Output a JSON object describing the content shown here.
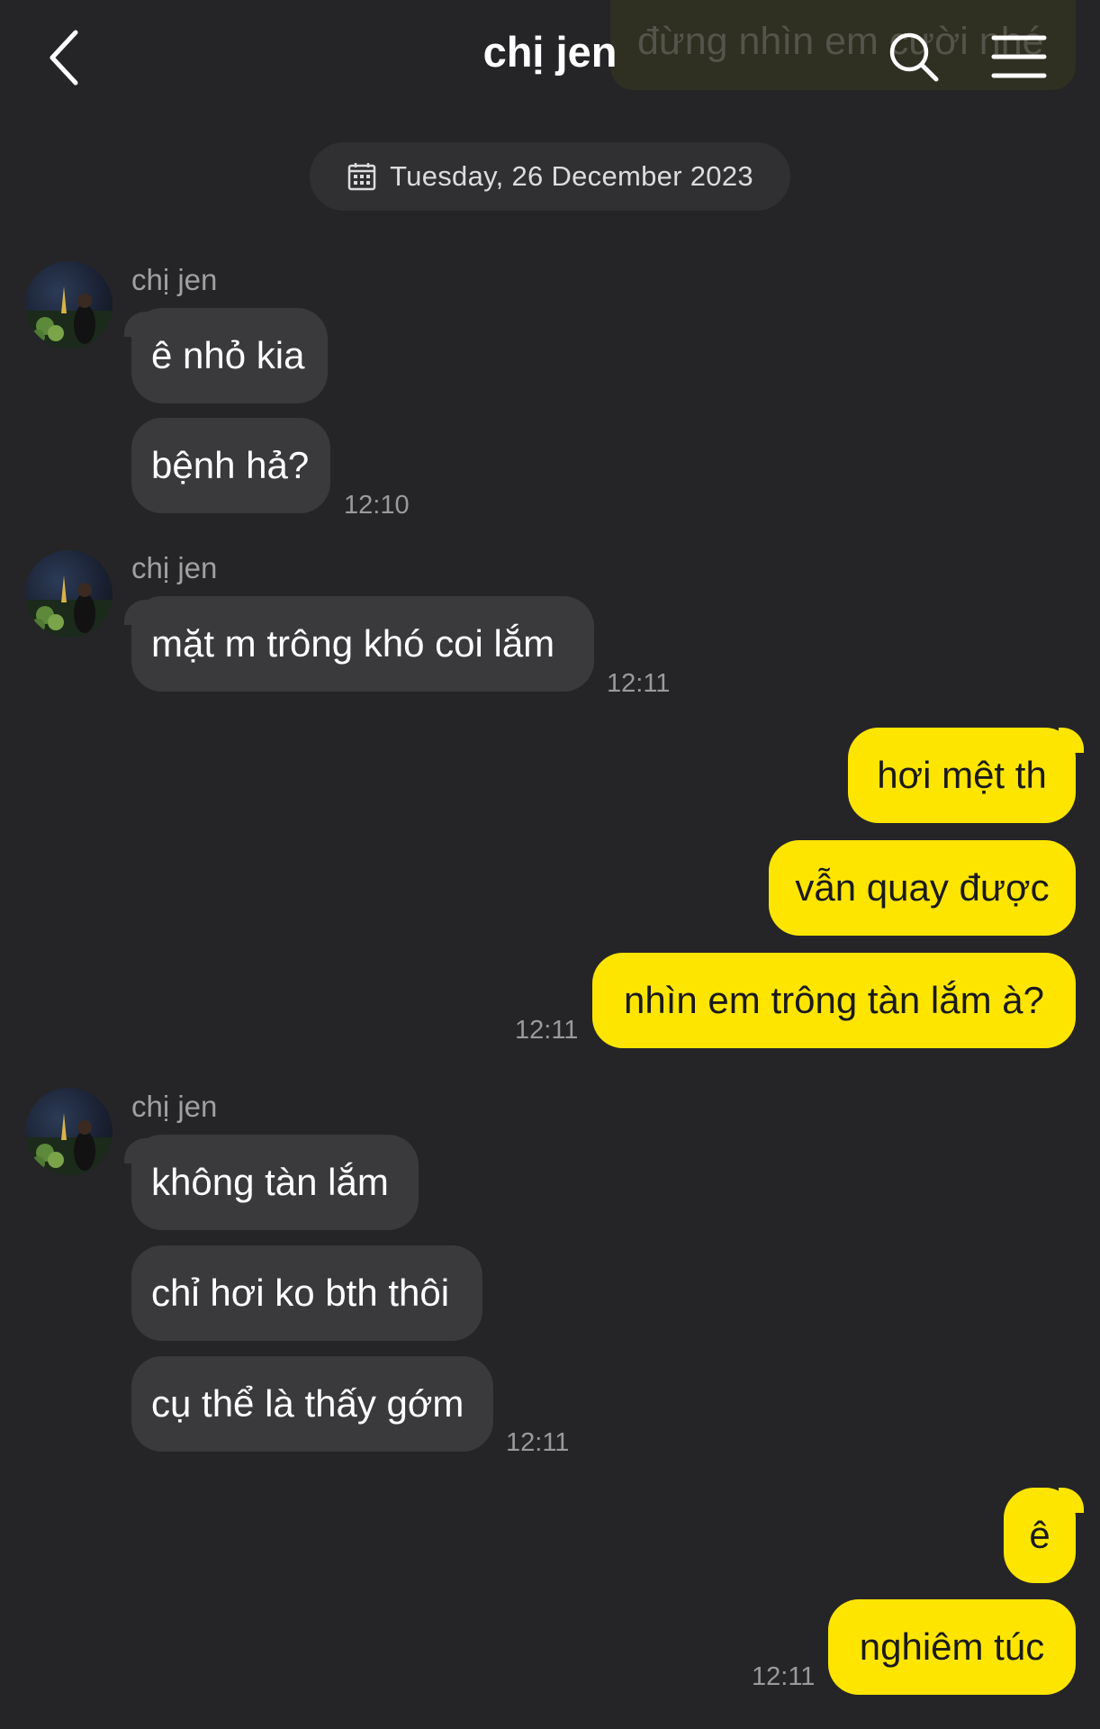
{
  "header": {
    "pinned_preview": "đừng nhìn em cười nhé",
    "title": "chị jen",
    "back_icon": "chevron-left-icon",
    "search_icon": "search-icon",
    "menu_icon": "hamburger-menu-icon"
  },
  "date_divider": "Tuesday, 26 December 2023",
  "groups": [
    {
      "sender": "chị jen",
      "messages": [
        "ê nhỏ kia",
        "bệnh hả?"
      ],
      "time": "12:10"
    },
    {
      "sender": "chị jen",
      "messages": [
        "mặt m trông khó coi lắm"
      ],
      "time": "12:11"
    },
    {
      "messages": [
        "hơi mệt th",
        "vẫn quay được",
        "nhìn em trông tàn lắm à?"
      ],
      "time": "12:11"
    },
    {
      "sender": "chị jen",
      "messages": [
        "không tàn lắm",
        "chỉ hơi ko bth thôi",
        "cụ thể là thấy gớm"
      ],
      "time": "12:11"
    },
    {
      "messages": [
        "ê",
        "nghiêm túc"
      ],
      "time": "12:11"
    }
  ],
  "colors": {
    "background": "#252528",
    "received_bubble": "#3a3a3d",
    "sent_bubble": "#fee500"
  }
}
